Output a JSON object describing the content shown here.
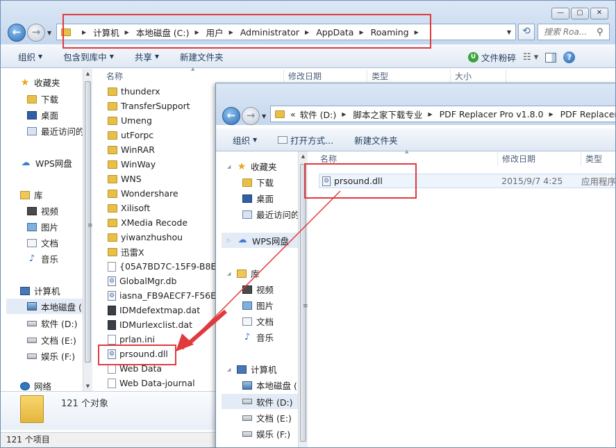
{
  "colors": {
    "accent_red": "#e0393e",
    "folder_yellow": "#e9c046",
    "toolbar_text": "#1e395b"
  },
  "win1": {
    "address": [
      "计算机",
      "本地磁盘 (C:)",
      "用户",
      "Administrator",
      "AppData",
      "Roaming"
    ],
    "search_placeholder": "搜索 Roa...",
    "toolbar": {
      "organize": "组织",
      "include_in_library": "包含到库中",
      "share": "共享",
      "new_folder": "新建文件夹",
      "smash": "文件粉碎"
    },
    "nav": {
      "favorites": "收藏夹",
      "downloads": "下载",
      "desktop": "桌面",
      "recent": "最近访问的",
      "wps": "WPS网盘",
      "libraries": "库",
      "videos": "视频",
      "pictures": "图片",
      "documents": "文档",
      "music": "音乐",
      "computer": "计算机",
      "drive_c": "本地磁盘 (",
      "drive_d": "软件 (D:)",
      "drive_e": "文档 (E:)",
      "drive_f": "娱乐 (F:)",
      "network": "网络"
    },
    "columns": {
      "name": "名称",
      "modified": "修改日期",
      "type": "类型",
      "size": "大小"
    },
    "files": [
      {
        "name": "thunderx",
        "kind": "folder"
      },
      {
        "name": "TransferSupport",
        "kind": "folder"
      },
      {
        "name": "Umeng",
        "kind": "folder"
      },
      {
        "name": "utForpc",
        "kind": "folder"
      },
      {
        "name": "WinRAR",
        "kind": "folder"
      },
      {
        "name": "WinWay",
        "kind": "folder"
      },
      {
        "name": "WNS",
        "kind": "folder"
      },
      {
        "name": "Wondershare",
        "kind": "folder"
      },
      {
        "name": "Xilisoft",
        "kind": "folder"
      },
      {
        "name": "XMedia Recode",
        "kind": "folder"
      },
      {
        "name": "yiwanzhushou",
        "kind": "folder"
      },
      {
        "name": "迅雷X",
        "kind": "folder"
      },
      {
        "name": "{05A7BD7C-15F9-B8E5-",
        "kind": "file"
      },
      {
        "name": "GlobalMgr.db",
        "kind": "dll"
      },
      {
        "name": "iasna_FB9AECF7-F56E-7",
        "kind": "dll"
      },
      {
        "name": "IDMdefextmap.dat",
        "kind": "dat"
      },
      {
        "name": "IDMurlexclist.dat",
        "kind": "dat"
      },
      {
        "name": "prlan.ini",
        "kind": "ini"
      },
      {
        "name": "prsound.dll",
        "kind": "dll"
      },
      {
        "name": "Web Data",
        "kind": "file"
      },
      {
        "name": "Web Data-journal",
        "kind": "file"
      }
    ],
    "details_count": "121 个对象",
    "status": "121 个项目"
  },
  "win2": {
    "address": [
      "软件 (D:)",
      "脚本之家下载专业",
      "PDF Replacer Pro v1.8.0",
      "PDF Replacer Pro"
    ],
    "address_prefix": "«",
    "toolbar": {
      "organize": "组织",
      "open_with": "打开方式...",
      "new_folder": "新建文件夹"
    },
    "nav": {
      "favorites": "收藏夹",
      "downloads": "下载",
      "desktop": "桌面",
      "recent": "最近访问的",
      "wps": "WPS网盘",
      "libraries": "库",
      "videos": "视频",
      "pictures": "图片",
      "documents": "文档",
      "music": "音乐",
      "computer": "计算机",
      "drive_c": "本地磁盘 (",
      "drive_d": "软件 (D:)",
      "drive_e": "文档 (E:)",
      "drive_f": "娱乐 (F:)"
    },
    "columns": {
      "name": "名称",
      "modified": "修改日期",
      "type": "类型"
    },
    "file": {
      "name": "prsound.dll",
      "modified": "2015/9/7 4:25",
      "type": "应用程序"
    }
  }
}
